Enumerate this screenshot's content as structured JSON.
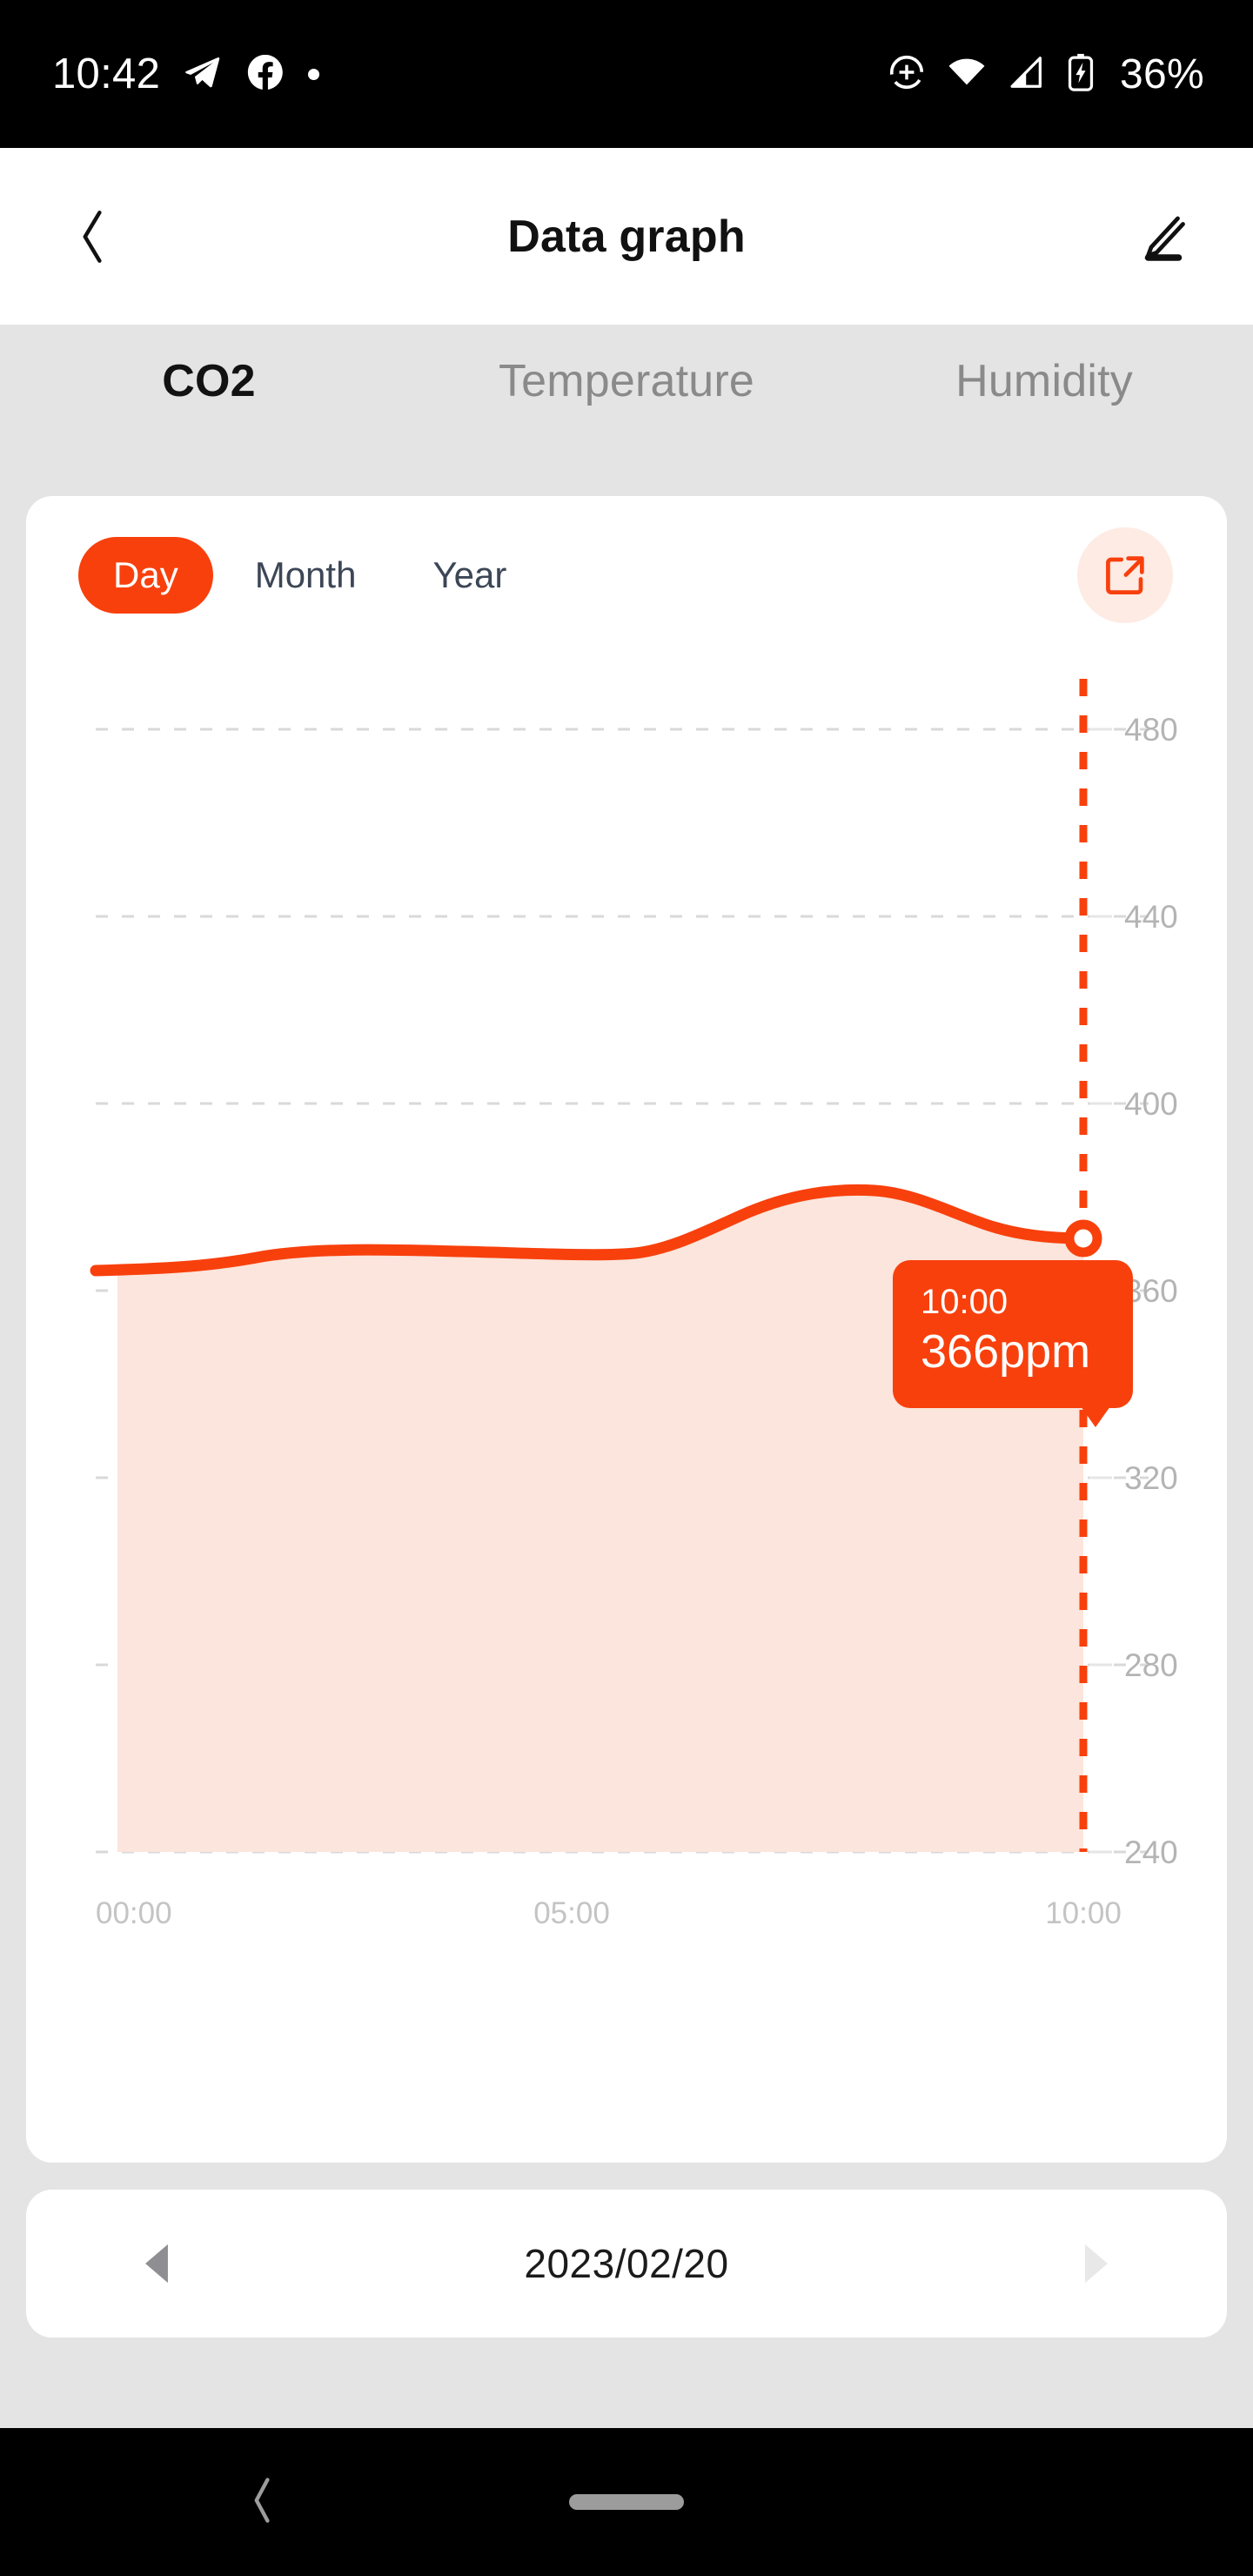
{
  "status_bar": {
    "time": "10:42",
    "battery_percent": "36%",
    "left_icons": [
      "telegram-icon",
      "facebook-icon",
      "notification-dot-icon"
    ],
    "right_icons": [
      "location-add-icon",
      "wifi-icon",
      "cellular-signal-icon",
      "battery-charging-icon"
    ],
    "background": "#000000"
  },
  "header": {
    "title": "Data graph",
    "back_icon": "chevron-left-icon",
    "edit_icon": "pencil-edit-icon"
  },
  "tabs": [
    {
      "label": "CO2",
      "active": true
    },
    {
      "label": "Temperature",
      "active": false
    },
    {
      "label": "Humidity",
      "active": false
    }
  ],
  "periods": [
    {
      "label": "Day",
      "active": true
    },
    {
      "label": "Month",
      "active": false
    },
    {
      "label": "Year",
      "active": false
    }
  ],
  "share_button": {
    "icon": "external-link-icon"
  },
  "tooltip": {
    "time": "10:00",
    "value": "366ppm"
  },
  "date_nav": {
    "date": "2023/02/20",
    "prev_icon": "triangle-left-icon",
    "next_icon": "triangle-right-icon",
    "prev_enabled": true,
    "next_enabled": false
  },
  "nav_bar": {
    "back_icon": "chevron-left-icon",
    "home_indicator": "home-pill"
  },
  "colors": {
    "accent": "#F8400D",
    "accent_fill": "#FBE5DC",
    "page_background": "#E4E4E4",
    "card_background": "#FFFFFF",
    "tab_inactive": "#8A8A8A",
    "grid": "#D9D9D9"
  },
  "chart_data": {
    "type": "area",
    "title": "CO2",
    "xlabel": "",
    "ylabel": "ppm",
    "unit": "ppm",
    "grid": true,
    "legend": "none",
    "ylim": [
      240,
      480
    ],
    "yticks": [
      480,
      440,
      400,
      360,
      320,
      280,
      240
    ],
    "xticks": [
      "00:00",
      "05:00",
      "10:00"
    ],
    "xlim": [
      "00:00",
      "10:00"
    ],
    "series": [
      {
        "name": "CO2",
        "color": "#F8400D",
        "fill_color": "#FBE5DC",
        "x": [
          "00:00",
          "00:30",
          "01:00",
          "01:30",
          "02:00",
          "02:30",
          "03:00",
          "03:30",
          "04:00",
          "04:30",
          "05:00",
          "05:30",
          "06:00",
          "06:30",
          "07:00",
          "07:30",
          "08:00",
          "08:30",
          "09:00",
          "09:30",
          "10:00"
        ],
        "values": [
          365,
          364,
          364,
          365,
          366,
          366,
          366,
          366,
          366,
          366,
          366,
          366,
          365,
          366,
          368,
          371,
          372,
          372,
          370,
          367,
          366
        ]
      }
    ],
    "highlight_point": {
      "x": "10:00",
      "y": 366,
      "label": "366ppm"
    }
  }
}
